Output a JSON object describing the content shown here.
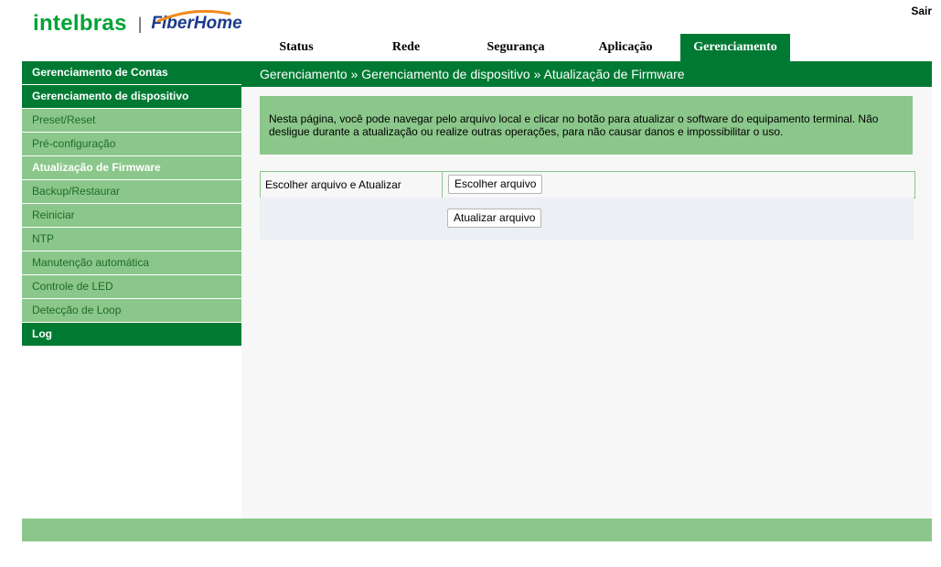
{
  "logo": {
    "brand": "intelbras",
    "partner": "FiberHome",
    "separator": "|"
  },
  "header": {
    "logout_label": "Sair"
  },
  "topnav": {
    "tabs": [
      {
        "label": "Status"
      },
      {
        "label": "Rede"
      },
      {
        "label": "Segurança"
      },
      {
        "label": "Aplicação"
      },
      {
        "label": "Gerenciamento",
        "active": true
      }
    ]
  },
  "breadcrumb": "Gerenciamento » Gerenciamento de dispositivo » Atualização de Firmware",
  "sidebar": {
    "items": [
      {
        "label": "Gerenciamento de Contas",
        "type": "header"
      },
      {
        "label": "Gerenciamento de dispositivo",
        "type": "header"
      },
      {
        "label": "Preset/Reset",
        "type": "sub"
      },
      {
        "label": "Pré-configuração",
        "type": "sub"
      },
      {
        "label": "Atualização de Firmware",
        "type": "sub",
        "active": true
      },
      {
        "label": "Backup/Restaurar",
        "type": "sub"
      },
      {
        "label": "Reiniciar",
        "type": "sub"
      },
      {
        "label": "NTP",
        "type": "sub"
      },
      {
        "label": "Manutenção automática",
        "type": "sub"
      },
      {
        "label": "Controle de LED",
        "type": "sub"
      },
      {
        "label": "Detecção de Loop",
        "type": "sub"
      },
      {
        "label": "Log",
        "type": "header"
      }
    ]
  },
  "main": {
    "info_text": "Nesta página, você pode navegar pelo arquivo local e clicar no botão para atualizar o software do equipamento terminal. Não desligue durante a atualização ou realize outras operações, para não causar danos e impossibilitar o uso.",
    "form_label": "Escolher arquivo e Atualizar",
    "choose_file_button": "Escolher arquivo",
    "update_button": "Atualizar arquivo"
  },
  "colors": {
    "primary_green": "#007a33",
    "light_green": "#8bc78a",
    "brand_green": "#00a335",
    "fiberhome_blue": "#1a3a8c"
  }
}
